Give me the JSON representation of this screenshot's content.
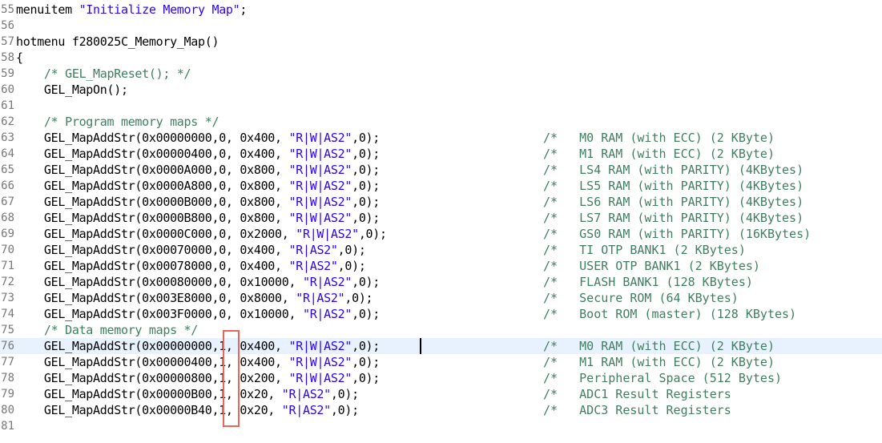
{
  "editor": {
    "lines": [
      {
        "num": "55",
        "parts": [
          [
            "t",
            "menuitem "
          ],
          [
            "s",
            "\"Initialize Memory Map\""
          ],
          [
            "t",
            ";"
          ]
        ],
        "comment": ""
      },
      {
        "num": "56",
        "parts": [],
        "comment": ""
      },
      {
        "num": "57",
        "parts": [
          [
            "t",
            "hotmenu f280025C_Memory_Map()"
          ]
        ],
        "comment": ""
      },
      {
        "num": "58",
        "parts": [
          [
            "t",
            "{"
          ]
        ],
        "comment": ""
      },
      {
        "num": "59",
        "parts": [
          [
            "c",
            "    /* GEL_MapReset(); */"
          ]
        ],
        "comment": ""
      },
      {
        "num": "60",
        "parts": [
          [
            "t",
            "    GEL_MapOn();"
          ]
        ],
        "comment": ""
      },
      {
        "num": "61",
        "parts": [],
        "comment": ""
      },
      {
        "num": "62",
        "parts": [
          [
            "c",
            "    /* Program memory maps */"
          ]
        ],
        "comment": ""
      },
      {
        "num": "63",
        "parts": [
          [
            "t",
            "    GEL_MapAddStr(0x00000000,0, 0x400, "
          ],
          [
            "s",
            "\"R|W|AS2\""
          ],
          [
            "t",
            ",0);"
          ]
        ],
        "comment": "/*   M0 RAM (with ECC) (2 KByte)"
      },
      {
        "num": "64",
        "parts": [
          [
            "t",
            "    GEL_MapAddStr(0x00000400,0, 0x400, "
          ],
          [
            "s",
            "\"R|W|AS2\""
          ],
          [
            "t",
            ",0);"
          ]
        ],
        "comment": "/*   M1 RAM (with ECC) (2 KByte)"
      },
      {
        "num": "65",
        "parts": [
          [
            "t",
            "    GEL_MapAddStr(0x0000A000,0, 0x800, "
          ],
          [
            "s",
            "\"R|W|AS2\""
          ],
          [
            "t",
            ",0);"
          ]
        ],
        "comment": "/*   LS4 RAM (with PARITY) (4KBytes)"
      },
      {
        "num": "66",
        "parts": [
          [
            "t",
            "    GEL_MapAddStr(0x0000A800,0, 0x800, "
          ],
          [
            "s",
            "\"R|W|AS2\""
          ],
          [
            "t",
            ",0);"
          ]
        ],
        "comment": "/*   LS5 RAM (with PARITY) (4KBytes)"
      },
      {
        "num": "67",
        "parts": [
          [
            "t",
            "    GEL_MapAddStr(0x0000B000,0, 0x800, "
          ],
          [
            "s",
            "\"R|W|AS2\""
          ],
          [
            "t",
            ",0);"
          ]
        ],
        "comment": "/*   LS6 RAM (with PARITY) (4KBytes)"
      },
      {
        "num": "68",
        "parts": [
          [
            "t",
            "    GEL_MapAddStr(0x0000B800,0, 0x800, "
          ],
          [
            "s",
            "\"R|W|AS2\""
          ],
          [
            "t",
            ",0);"
          ]
        ],
        "comment": "/*   LS7 RAM (with PARITY) (4KBytes)"
      },
      {
        "num": "69",
        "parts": [
          [
            "t",
            "    GEL_MapAddStr(0x0000C000,0, 0x2000, "
          ],
          [
            "s",
            "\"R|W|AS2\""
          ],
          [
            "t",
            ",0);"
          ]
        ],
        "comment": "/*   GS0 RAM (with PARITY) (16KBytes)"
      },
      {
        "num": "70",
        "parts": [
          [
            "t",
            "    GEL_MapAddStr(0x00070000,0, 0x400, "
          ],
          [
            "s",
            "\"R|AS2\""
          ],
          [
            "t",
            ",0);"
          ]
        ],
        "comment": "/*   TI OTP BANK1 (2 KBytes)"
      },
      {
        "num": "71",
        "parts": [
          [
            "t",
            "    GEL_MapAddStr(0x00078000,0, 0x400, "
          ],
          [
            "s",
            "\"R|AS2\""
          ],
          [
            "t",
            ",0);"
          ]
        ],
        "comment": "/*   USER OTP BANK1 (2 KBytes)"
      },
      {
        "num": "72",
        "parts": [
          [
            "t",
            "    GEL_MapAddStr(0x00080000,0, 0x10000, "
          ],
          [
            "s",
            "\"R|AS2\""
          ],
          [
            "t",
            ",0);"
          ]
        ],
        "comment": "/*   FLASH BANK1 (128 KBytes)"
      },
      {
        "num": "73",
        "parts": [
          [
            "t",
            "    GEL_MapAddStr(0x003E8000,0, 0x8000, "
          ],
          [
            "s",
            "\"R|AS2\""
          ],
          [
            "t",
            ",0);"
          ]
        ],
        "comment": "/*   Secure ROM (64 KBytes)"
      },
      {
        "num": "74",
        "parts": [
          [
            "t",
            "    GEL_MapAddStr(0x003F0000,0, 0x10000, "
          ],
          [
            "s",
            "\"R|AS2\""
          ],
          [
            "t",
            ",0);"
          ]
        ],
        "comment": "/*   Boot ROM (master) (128 KBytes)"
      },
      {
        "num": "75",
        "parts": [
          [
            "c",
            "    /* Data memory maps */"
          ]
        ],
        "comment": ""
      },
      {
        "num": "76",
        "parts": [
          [
            "t",
            "    GEL_MapAddStr(0x00000000,1, 0x400, "
          ],
          [
            "s",
            "\"R|W|AS2\""
          ],
          [
            "t",
            ",0);"
          ]
        ],
        "comment": "/*   M0 RAM (with ECC) (2 KByte)"
      },
      {
        "num": "77",
        "parts": [
          [
            "t",
            "    GEL_MapAddStr(0x00000400,1, 0x400, "
          ],
          [
            "s",
            "\"R|W|AS2\""
          ],
          [
            "t",
            ",0);"
          ]
        ],
        "comment": "/*   M1 RAM (with ECC) (2 KByte)"
      },
      {
        "num": "78",
        "parts": [
          [
            "t",
            "    GEL_MapAddStr(0x00000800,1, 0x200, "
          ],
          [
            "s",
            "\"R|W|AS2\""
          ],
          [
            "t",
            ",0);"
          ]
        ],
        "comment": "/*   Peripheral Space (512 Bytes)"
      },
      {
        "num": "79",
        "parts": [
          [
            "t",
            "    GEL_MapAddStr(0x00000B00,1, 0x20, "
          ],
          [
            "s",
            "\"R|AS2\""
          ],
          [
            "t",
            ",0);"
          ]
        ],
        "comment": "/*   ADC1 Result Registers"
      },
      {
        "num": "80",
        "parts": [
          [
            "t",
            "    GEL_MapAddStr(0x00000B40,1, 0x20, "
          ],
          [
            "s",
            "\"R|AS2\""
          ],
          [
            "t",
            ",0);"
          ]
        ],
        "comment": "/*   ADC3 Result Registers"
      },
      {
        "num": "81",
        "parts": [],
        "comment": ""
      }
    ],
    "current_line_index": 21,
    "colors": {
      "string": "#2a00ff",
      "comment": "#3f7f5f",
      "line_number": "#787878",
      "current_line": "#e8f2fe",
      "highlight_box": "#e8675c"
    }
  }
}
